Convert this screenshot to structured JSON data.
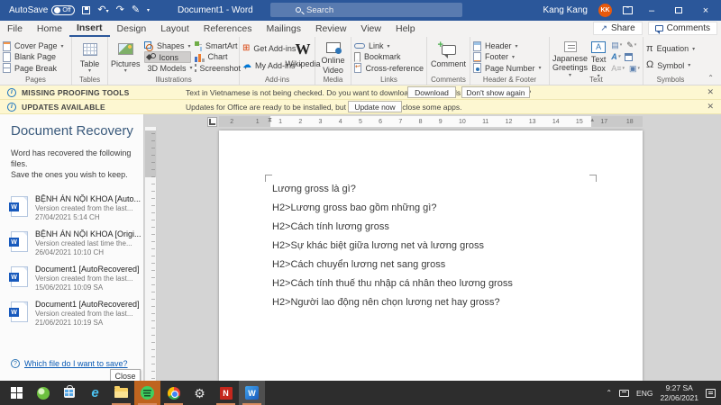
{
  "titlebar": {
    "autosave_label": "AutoSave",
    "autosave_state": "Off",
    "title": "Document1 - Word",
    "search": "Search",
    "user": "Kang Kang",
    "initials": "KK"
  },
  "tabs": {
    "items": [
      "File",
      "Home",
      "Insert",
      "Design",
      "Layout",
      "References",
      "Mailings",
      "Review",
      "View",
      "Help"
    ],
    "active": "Insert",
    "share": "Share",
    "comments": "Comments"
  },
  "ribbon": {
    "pages": {
      "label": "Pages",
      "cover": "Cover Page",
      "blank": "Blank Page",
      "brk": "Page Break"
    },
    "tables": {
      "label": "Tables",
      "table": "Table"
    },
    "illustrations": {
      "label": "Illustrations",
      "pictures": "Pictures",
      "shapes": "Shapes",
      "icons": "Icons",
      "models": "3D Models",
      "smartart": "SmartArt",
      "chart": "Chart",
      "screenshot": "Screenshot"
    },
    "addins": {
      "label": "Add-ins",
      "get": "Get Add-ins",
      "my": "My Add-ins",
      "wikipedia": "Wikipedia"
    },
    "media": {
      "label": "Media",
      "video": "Online Video"
    },
    "links": {
      "label": "Links",
      "link": "Link",
      "bookmark": "Bookmark",
      "crossref": "Cross-reference"
    },
    "comments": {
      "label": "Comments",
      "comment": "Comment"
    },
    "header_footer": {
      "label": "Header & Footer",
      "header": "Header",
      "footer": "Footer",
      "pagenum": "Page Number"
    },
    "text": {
      "label": "Text",
      "japanese": "Japanese Greetings",
      "textbox": "Text Box"
    },
    "symbols": {
      "label": "Symbols",
      "equation": "Equation",
      "symbol": "Symbol"
    }
  },
  "notifications": [
    {
      "title": "MISSING PROOFING TOOLS",
      "message": "Text in Vietnamese is not being checked. Do you want to download proofing tools and future updates?",
      "primary": "Download",
      "secondary": "Don't show again"
    },
    {
      "title": "UPDATES AVAILABLE",
      "message": "Updates for Office are ready to be installed, but first we need to close some apps.",
      "primary": "Update now"
    }
  ],
  "recovery": {
    "title": "Document Recovery",
    "intro1": "Word has recovered the following files.",
    "intro2": "Save the ones you wish to keep.",
    "files": [
      {
        "name": "BỆNH ÁN NỘI KHOA [Auto...",
        "detail": "Version created from the last...",
        "date": "27/04/2021 5:14 CH"
      },
      {
        "name": "BỆNH ÁN NỘI KHOA [Origi...",
        "detail": "Version created last time the...",
        "date": "26/04/2021 10:10 CH"
      },
      {
        "name": "Document1 [AutoRecovered]",
        "detail": "Version created from the last...",
        "date": "15/06/2021 10:09 SA"
      },
      {
        "name": "Document1 [AutoRecovered]",
        "detail": "Version created from the last...",
        "date": "21/06/2021 10:19 SA"
      }
    ],
    "help": "Which file do I want to save?",
    "close": "Close"
  },
  "ruler": {
    "left": [
      "2",
      "1"
    ],
    "main": [
      "1",
      "2",
      "3",
      "4",
      "5",
      "6",
      "7",
      "8",
      "9",
      "10",
      "11",
      "12",
      "13",
      "14",
      "15"
    ],
    "right": [
      "17",
      "18"
    ]
  },
  "document": {
    "lines": [
      "Lương gross là gì?",
      "H2>Lương gross bao gồm những gì?",
      "H2>Cách tính lương gross",
      "H2>Sự khác biệt giữa lương net và lương gross",
      "H2>Cách chuyển lương net sang gross",
      "H2>Cách tính thuế thu nhập cá nhân theo lương gross",
      "H2>Người lao động nên chọn lương net hay gross?"
    ]
  },
  "taskbar": {
    "icons": [
      "start",
      "green-app",
      "microsoft-store",
      "internet-explorer",
      "file-explorer",
      "spotify",
      "chrome",
      "settings",
      "app-n",
      "word"
    ],
    "language": "ENG",
    "time": "9:27 SA",
    "date": "22/06/2021"
  },
  "colors": {
    "titlebar": "#2b579a",
    "notification_bg": "#fdf7d1",
    "taskbar": "#2d2d2d",
    "taskbar_accent": "#bf641f",
    "word_blue": "#185abd"
  }
}
